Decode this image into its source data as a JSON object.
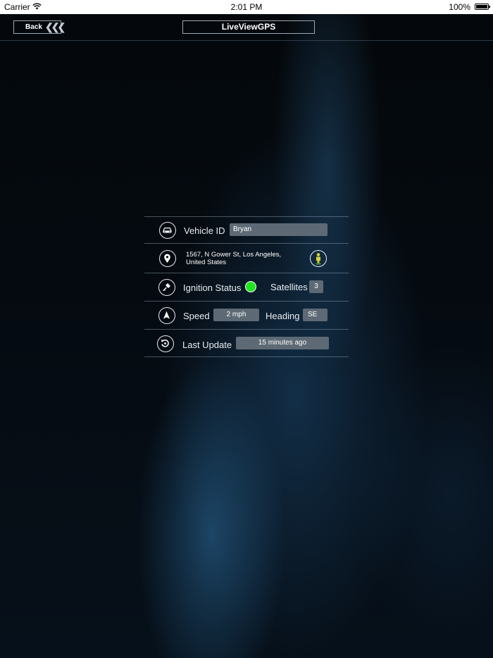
{
  "status_bar": {
    "carrier": "Carrier",
    "time": "2:01 PM",
    "battery": "100%"
  },
  "nav": {
    "back_label": "Back",
    "title": "LiveViewGPS"
  },
  "vehicle": {
    "id_label": "Vehicle ID",
    "id_value": "Bryan",
    "address": "1567, N Gower St, Los Angeles, United States",
    "ignition_label": "Ignition Status",
    "ignition_status_color": "#22e322",
    "satellites_label": "Satellites",
    "satellites_value": "3",
    "speed_label": "Speed",
    "speed_value": "2 mph",
    "heading_label": "Heading",
    "heading_value": "SE",
    "last_update_label": "Last Update",
    "last_update_value": "15 minutes ago"
  },
  "icons": {
    "car": "car-icon",
    "location": "location-pin-icon",
    "streetview": "street-view-person-icon",
    "ignition_key": "key-icon",
    "navigation": "navigation-arrow-icon",
    "refresh": "refresh-icon"
  }
}
